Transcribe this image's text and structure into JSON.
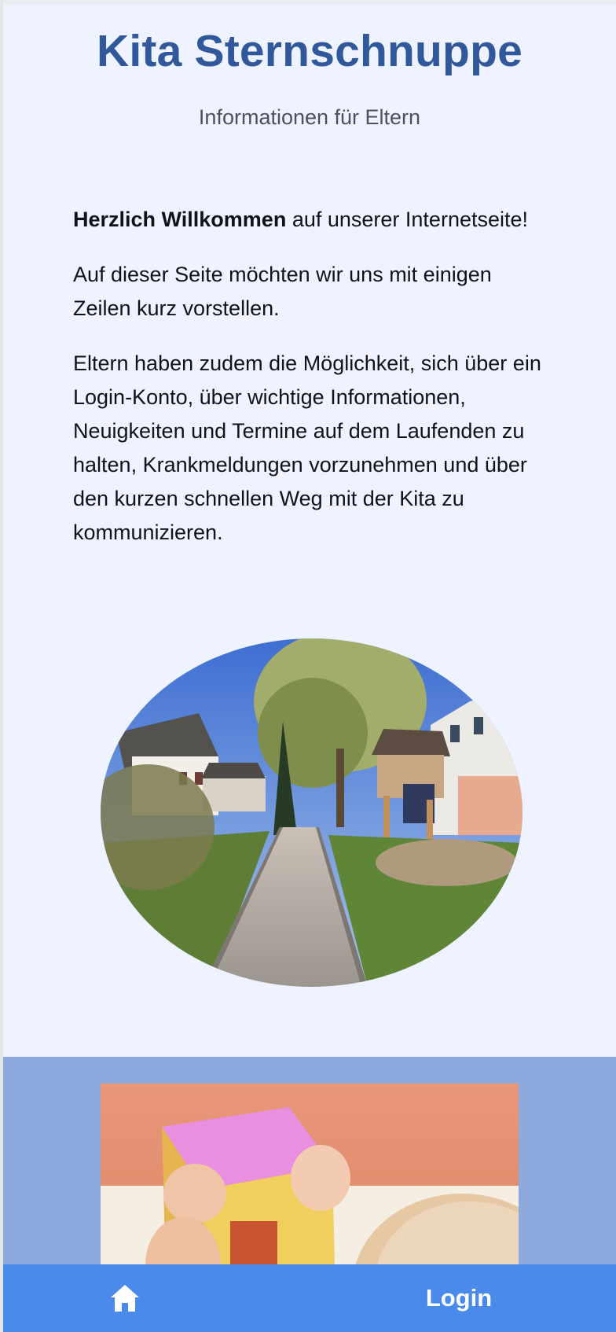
{
  "header": {
    "title": "Kita Sternschnuppe",
    "subtitle": "Informationen für Eltern"
  },
  "intro": {
    "welcome_bold": "Herzlich Willkommen",
    "welcome_rest": " auf unserer Internetseite!",
    "paragraph_2": "Auf dieser Seite möchten wir uns mit einigen Zeilen kurz vorstellen.",
    "paragraph_3": "Eltern haben zudem die Möglichkeit, sich über ein Login-Konto, über wichtige Informationen, Neuigkeiten und Termine auf dem Laufenden zu halten, Krankmeldungen vorzunehmen und über den kurzen schnellen Weg mit der Kita zu kommunizieren."
  },
  "images": {
    "garden_photo": "garden-path-photo",
    "child_photo": "child-with-toy-box-photo"
  },
  "nav": {
    "home_icon": "home-icon",
    "login_label": "Login"
  },
  "colors": {
    "title": "#30589a",
    "page_background": "#eef3ff",
    "band_background": "#8ea9dc",
    "nav_background": "#4a8aeb"
  }
}
